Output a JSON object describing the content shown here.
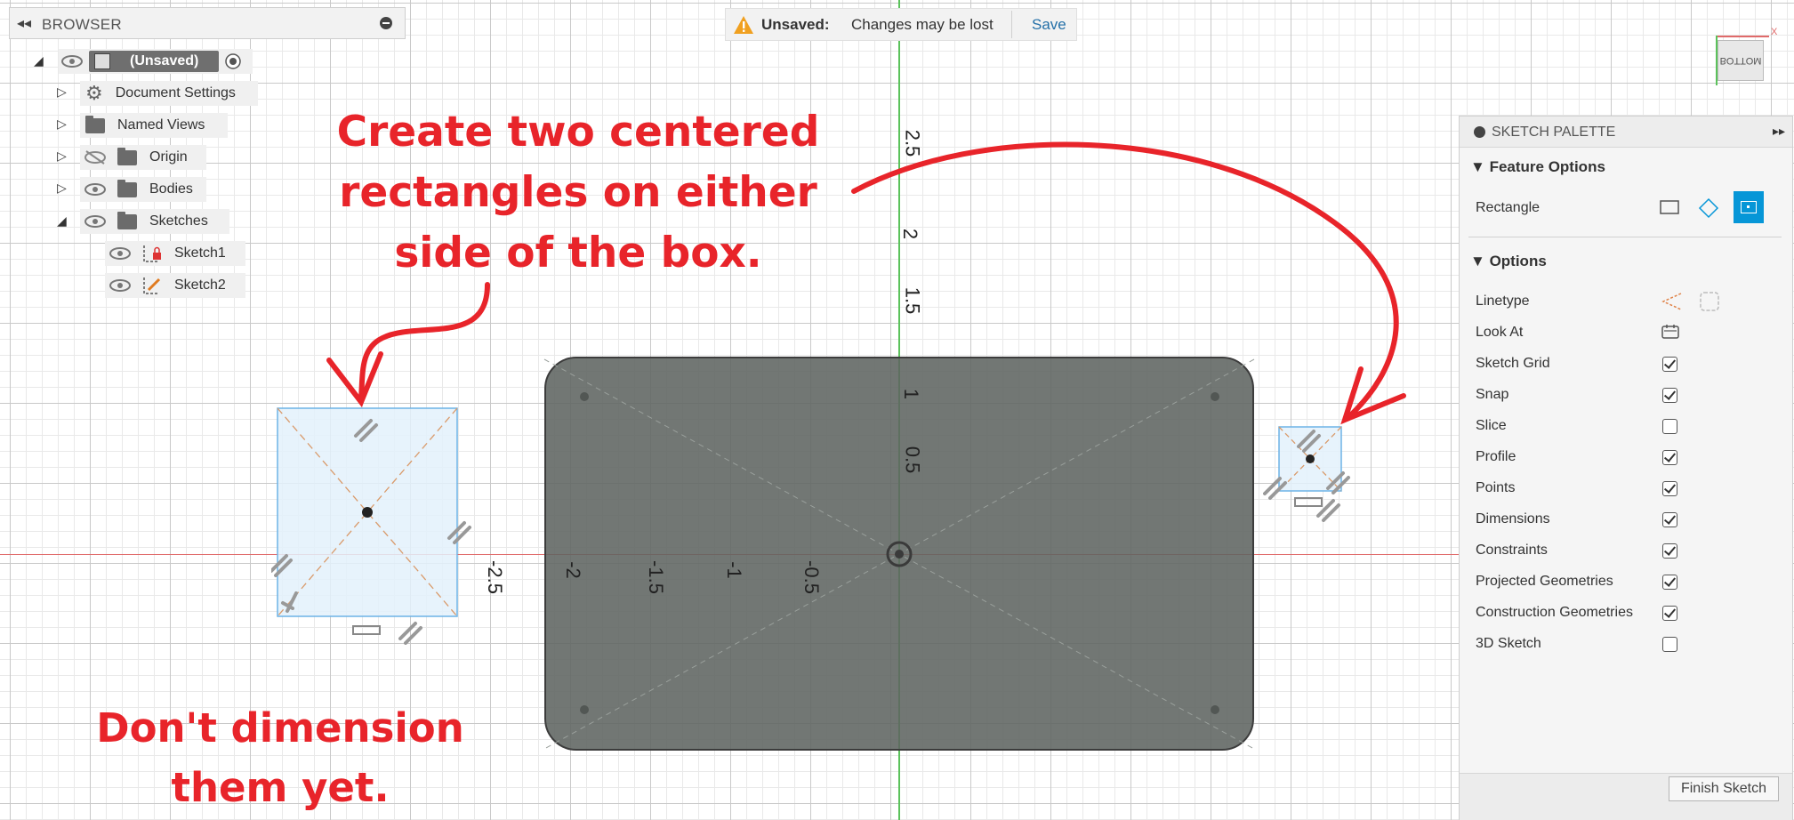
{
  "browser": {
    "title": "BROWSER",
    "root": "(Unsaved)",
    "items": [
      {
        "label": "Document Settings"
      },
      {
        "label": "Named Views"
      },
      {
        "label": "Origin"
      },
      {
        "label": "Bodies"
      },
      {
        "label": "Sketches"
      },
      {
        "label": "Sketch1"
      },
      {
        "label": "Sketch2"
      }
    ]
  },
  "status": {
    "unsaved_label": "Unsaved:",
    "message": "Changes may be lost",
    "save_label": "Save"
  },
  "viewcube": {
    "face": "BOTTOM"
  },
  "palette": {
    "title": "SKETCH PALETTE",
    "feature_options": {
      "heading": "Feature Options",
      "rectangle_label": "Rectangle"
    },
    "options": {
      "heading": "Options",
      "linetype": "Linetype",
      "look_at": "Look At",
      "rows": [
        {
          "label": "Sketch Grid",
          "checked": true
        },
        {
          "label": "Snap",
          "checked": true
        },
        {
          "label": "Slice",
          "checked": false
        },
        {
          "label": "Profile",
          "checked": true
        },
        {
          "label": "Points",
          "checked": true
        },
        {
          "label": "Dimensions",
          "checked": true
        },
        {
          "label": "Constraints",
          "checked": true
        },
        {
          "label": "Projected Geometries",
          "checked": true
        },
        {
          "label": "Construction Geometries",
          "checked": true
        },
        {
          "label": "3D Sketch",
          "checked": false
        }
      ]
    },
    "finish_label": "Finish Sketch"
  },
  "axis_labels": {
    "y": [
      "2.5",
      "2",
      "1.5",
      "1",
      "0.5"
    ],
    "x": [
      "-2.5",
      "-2",
      "-1.5",
      "-1",
      "-0.5"
    ]
  },
  "annotations": {
    "top": [
      "Create two centered",
      "rectangles on either",
      "side of the box."
    ],
    "bottom": [
      "Don't dimension",
      "them yet."
    ]
  },
  "colors": {
    "accent": "#0696d7",
    "annotation": "#e8242a",
    "body": "#6e736f",
    "x_axis": "#e06a6a",
    "y_axis": "#5bc25b"
  }
}
